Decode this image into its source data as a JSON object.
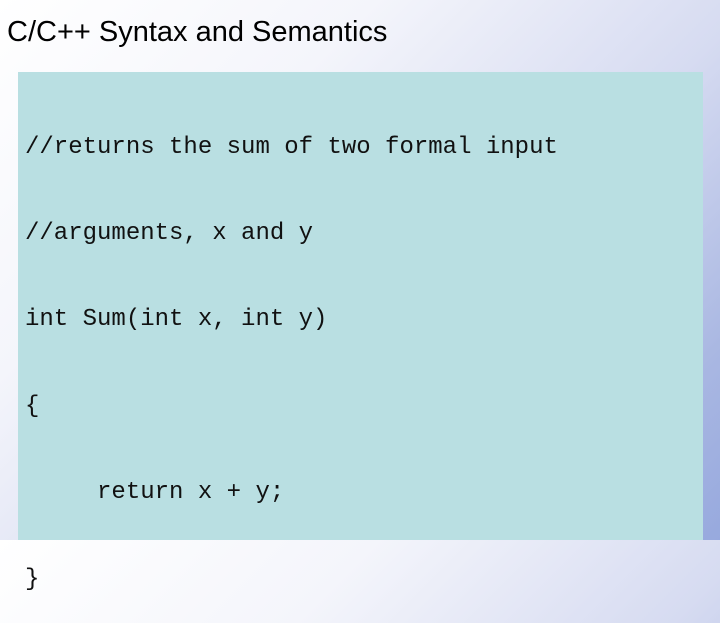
{
  "slide": {
    "title": "C/C++ Syntax and Semantics",
    "background_colors": [
      "#ffffff",
      "#97a9de"
    ],
    "code_box_color": "#b9dfe2"
  },
  "code": {
    "lines": [
      "//returns the sum of two formal input",
      "//arguments, x and y",
      "int Sum(int x, int y)",
      "{",
      "     return x + y;",
      "}"
    ]
  }
}
